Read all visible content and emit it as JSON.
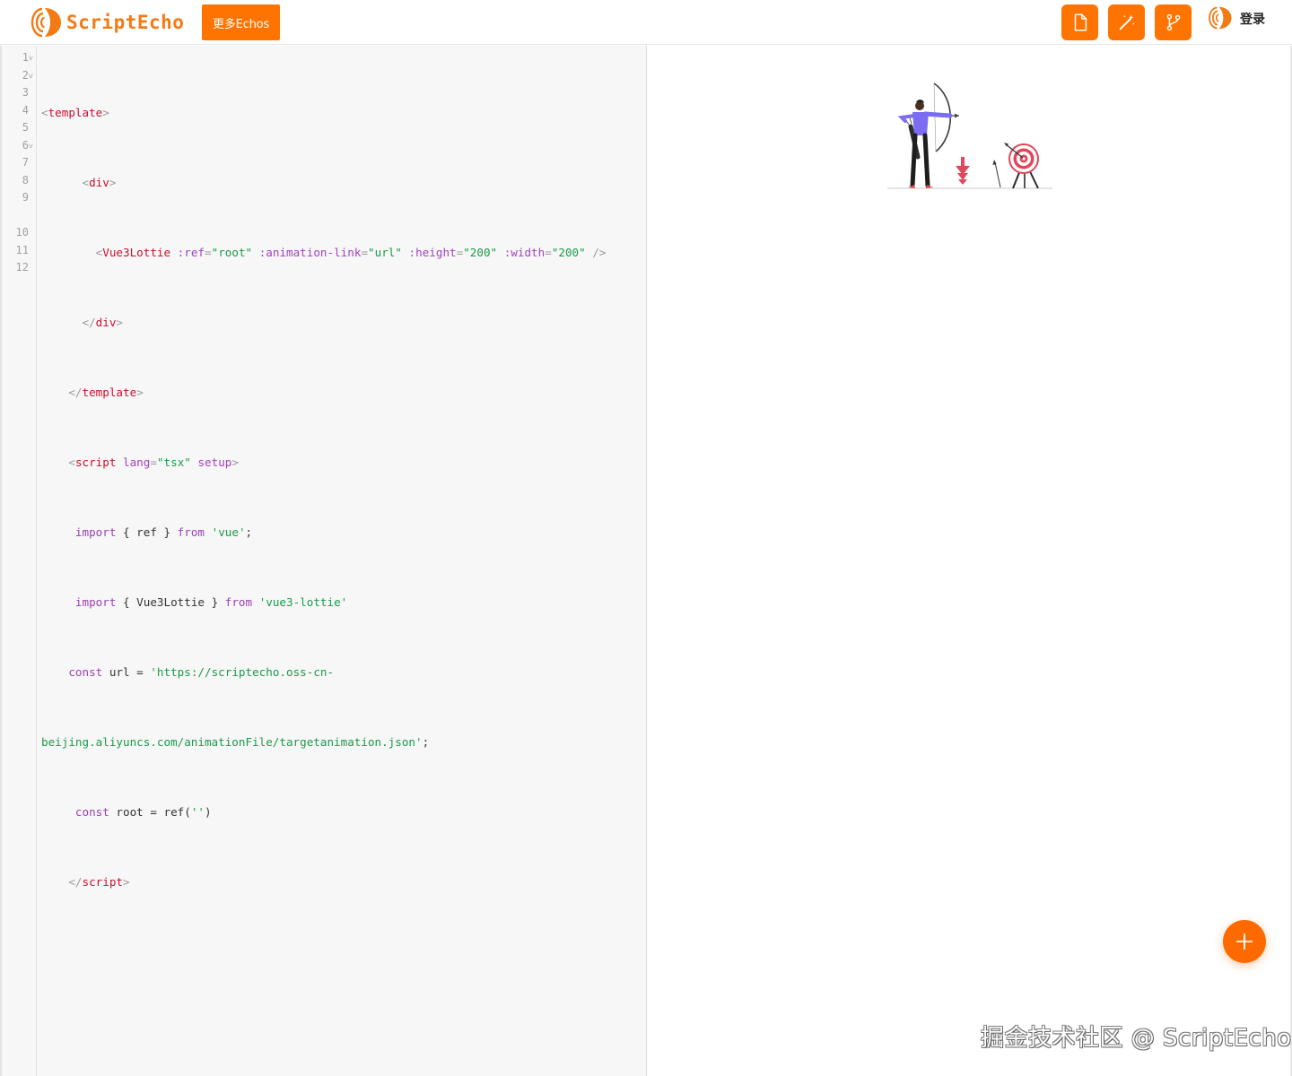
{
  "header": {
    "logo_text": "ScriptEcho",
    "more_button_label": "更多Echos",
    "tools": [
      {
        "name": "file-icon"
      },
      {
        "name": "magic-wand-icon"
      },
      {
        "name": "branch-icon"
      }
    ],
    "login_label": "登录"
  },
  "editor": {
    "line_numbers": [
      "1",
      "2",
      "3",
      "4",
      "5",
      "6",
      "7",
      "8",
      "9",
      "",
      "10",
      "11",
      "12"
    ],
    "folded_lines": [
      "1",
      "2",
      "6"
    ],
    "code": {
      "l1": {
        "open": "<",
        "tag": "template",
        "close": ">"
      },
      "l2": {
        "indent": "      ",
        "open": "<",
        "tag": "div",
        "close": ">"
      },
      "l3": {
        "indent": "        ",
        "open": "<",
        "tag": "Vue3Lottie",
        "a1": " :ref",
        "eq1": "=",
        "v1": "\"root\"",
        "a2": " :animation-link",
        "eq2": "=",
        "v2": "\"url\"",
        "a3": " :height",
        "eq3": "=",
        "v3": "\"200\"",
        "a4": " :width",
        "eq4": "=",
        "v4": "\"200\"",
        "end": " />"
      },
      "l4": {
        "indent": "      ",
        "open": "</",
        "tag": "div",
        "close": ">"
      },
      "l5": {
        "indent": "    ",
        "open": "</",
        "tag": "template",
        "close": ">"
      },
      "l6": {
        "indent": "    ",
        "open": "<",
        "tag": "script",
        "a1": " lang",
        "eq1": "=",
        "v1": "\"tsx\"",
        "a2": " setup",
        "close": ">"
      },
      "l7": {
        "indent": "     ",
        "kw": "import",
        "mid": " { ref } ",
        "kw2": "from",
        "sp": " ",
        "str": "'vue'",
        "end": ";"
      },
      "l8": {
        "indent": "     ",
        "kw": "import",
        "mid": " { Vue3Lottie } ",
        "kw2": "from",
        "sp": " ",
        "str": "'vue3-lottie'"
      },
      "l9": {
        "indent": "    ",
        "kw": "const",
        "mid": " url = ",
        "str": "'https://scriptecho.oss-cn-"
      },
      "l9b": {
        "str": "beijing.aliyuncs.com/animationFile/targetanimation.json'",
        "end": ";"
      },
      "l10": {
        "indent": "     ",
        "kw": "const",
        "mid": " root = ref(",
        "str": "''",
        "end": ")"
      },
      "l11": {
        "indent": "    ",
        "open": "</",
        "tag": "script",
        "close": ">"
      }
    }
  },
  "preview": {
    "animation": "archer-target-animation",
    "fab_icon": "plus-icon",
    "watermark": "掘金技术社区 @ ScriptEcho"
  },
  "colors": {
    "brand": "#ff7300",
    "tag": "#c8102e",
    "attr": "#a241c2",
    "string": "#1a9a4a"
  }
}
